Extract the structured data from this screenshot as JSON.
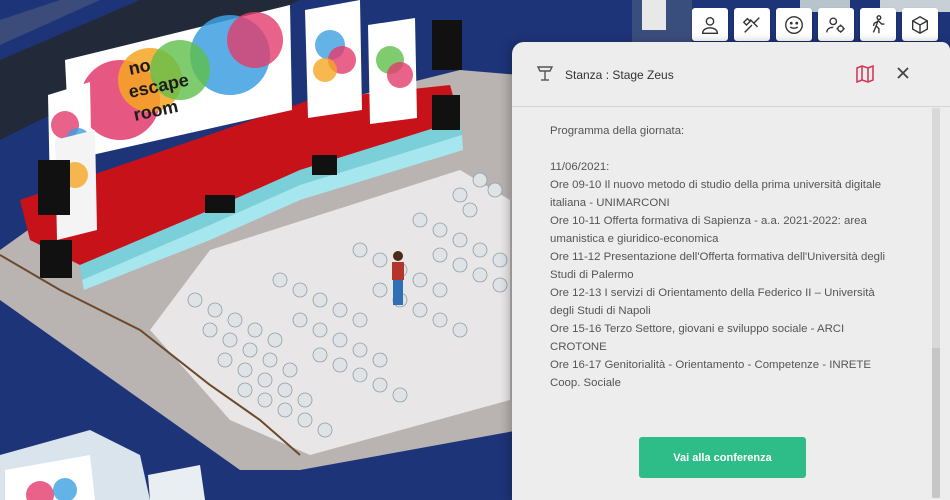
{
  "toolbar": {
    "buttons": [
      {
        "icon": "user-icon"
      },
      {
        "icon": "wrench-tools-icon"
      },
      {
        "icon": "smiley-icon"
      },
      {
        "icon": "user-settings-icon"
      },
      {
        "icon": "walking-person-icon"
      },
      {
        "icon": "cube-icon"
      }
    ]
  },
  "scene": {
    "screen_text": [
      "no",
      "escape",
      "room"
    ]
  },
  "panel": {
    "room_label": "Stanza : Stage Zeus",
    "intro": "Programma della giornata:",
    "date": "11/06/2021:",
    "entries": [
      "Ore 09-10 Il nuovo metodo di studio della prima università digitale italiana - UNIMARCONI",
      "Ore 10-11 Offerta formativa di Sapienza - a.a. 2021-2022: area umanistica e giuridico-economica",
      "Ore 11-12 Presentazione dell'Offerta formativa dell'Università degli Studi di Palermo",
      "Ore 12-13 I servizi di Orientamento della Federico II – Università degli Studi di Napoli",
      "Ore 15-16 Terzo Settore, giovani e sviluppo sociale - ARCI CROTONE",
      "Ore 16-17 Genitorialità - Orientamento - Competenze - INRETE Coop. Sociale"
    ],
    "cta_label": "Vai alla conferenza"
  },
  "colors": {
    "background": "#1e3479",
    "accent": "#2ebd88",
    "map_icon": "#d23a5c",
    "stage_red": "#c8121a"
  }
}
